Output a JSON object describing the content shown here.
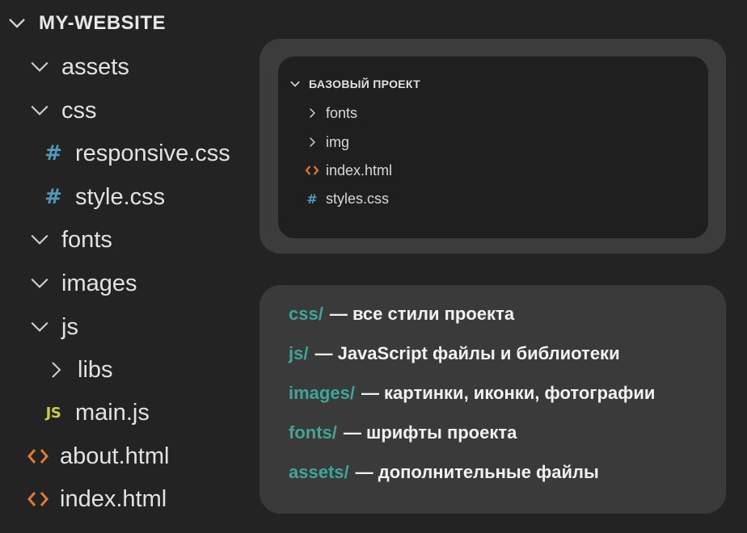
{
  "explorer": {
    "root": {
      "label": "MY-WEBSITE",
      "icon": "chevron-down-icon"
    },
    "items": [
      {
        "label": "assets",
        "icon": "chevron-down-icon"
      },
      {
        "label": "css",
        "icon": "chevron-down-icon"
      },
      {
        "label": "responsive.css",
        "icon": "css-file-icon",
        "glyph": "#"
      },
      {
        "label": "style.css",
        "icon": "css-file-icon",
        "glyph": "#"
      },
      {
        "label": "fonts",
        "icon": "chevron-down-icon"
      },
      {
        "label": "images",
        "icon": "chevron-down-icon"
      },
      {
        "label": "js",
        "icon": "chevron-down-icon"
      },
      {
        "label": "libs",
        "icon": "chevron-right-icon"
      },
      {
        "label": "main.js",
        "icon": "js-file-icon",
        "glyph": "JS"
      },
      {
        "label": "about.html",
        "icon": "html-file-icon"
      },
      {
        "label": "index.html",
        "icon": "html-file-icon"
      }
    ]
  },
  "base_project": {
    "root": {
      "label": "БАЗОВЫЙ ПРОЕКТ",
      "icon": "chevron-down-icon"
    },
    "items": [
      {
        "label": "fonts",
        "icon": "chevron-right-icon"
      },
      {
        "label": "img",
        "icon": "chevron-right-icon"
      },
      {
        "label": "index.html",
        "icon": "html-file-icon"
      },
      {
        "label": "styles.css",
        "icon": "css-file-icon",
        "glyph": "#"
      }
    ]
  },
  "descriptions": [
    {
      "key": "css/",
      "text": "— все стили проекта"
    },
    {
      "key": "js/",
      "text": "— JavaScript файлы и библиотеки"
    },
    {
      "key": "images/",
      "text": "— картинки, иконки, фотографии"
    },
    {
      "key": "fonts/",
      "text": "— шрифты проекта"
    },
    {
      "key": "assets/",
      "text": "— дополнительные файлы"
    }
  ],
  "colors": {
    "background": "#232323",
    "css_icon": "#519aba",
    "js_icon": "#cbcb41",
    "html_icon": "#e37933",
    "description_key": "#3fa59a"
  }
}
